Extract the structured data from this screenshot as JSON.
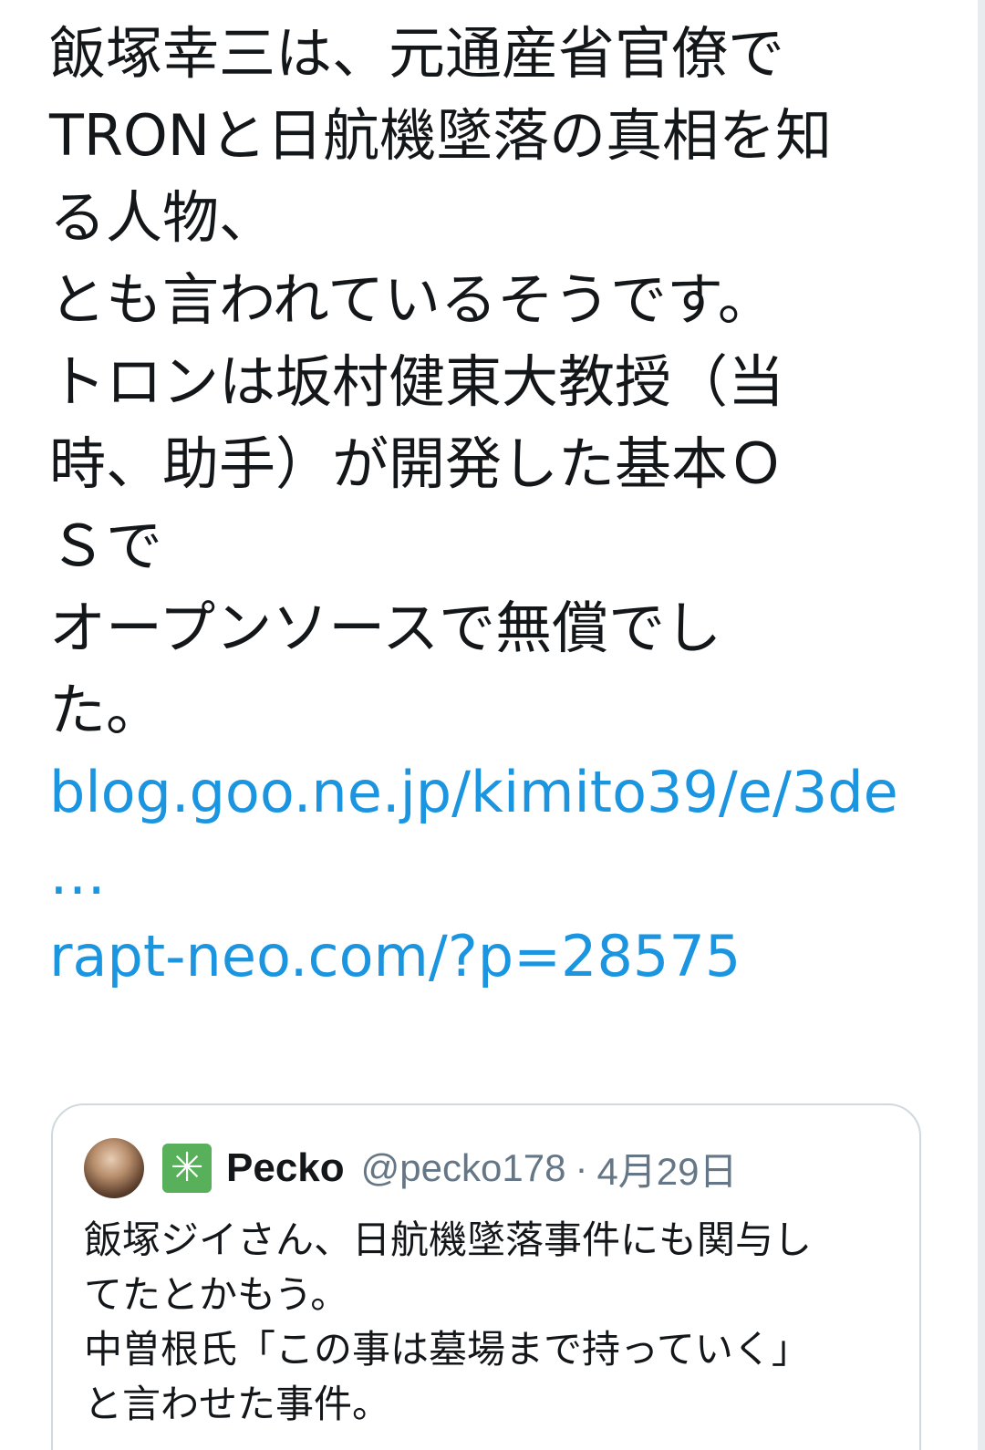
{
  "tweet": {
    "lines": [
      "飯塚幸三は、元通産省官僚で",
      "TRONと日航機墜落の真相を知",
      "る人物、",
      "とも言われているそうです。",
      "トロンは坂村健東大教授（当",
      "時、助手）が開発した基本Ｏ",
      "Ｓで",
      "オープンソースで無償でし",
      "た。"
    ],
    "link1": "blog.goo.ne.jp/kimito39/e/3de",
    "link1_ellipsis": "…",
    "link2": "rapt-neo.com/?p=28575"
  },
  "quoted_tweet": {
    "badge_icon": "sparkle-badge-icon",
    "badge_glyph": "✳",
    "display_name": "Pecko",
    "handle": "@pecko178",
    "separator": "·",
    "date": "4月29日",
    "lines": [
      "飯塚ジイさん、日航機墜落事件にも関与し",
      "てたとかもう。",
      "中曽根氏「この事は墓場まで持っていく」",
      "と言わせた事件。"
    ]
  },
  "colors": {
    "text": "#14171a",
    "link": "#1b95e0",
    "muted": "#657786",
    "border": "#cfd9de",
    "badge": "#58b05a"
  }
}
